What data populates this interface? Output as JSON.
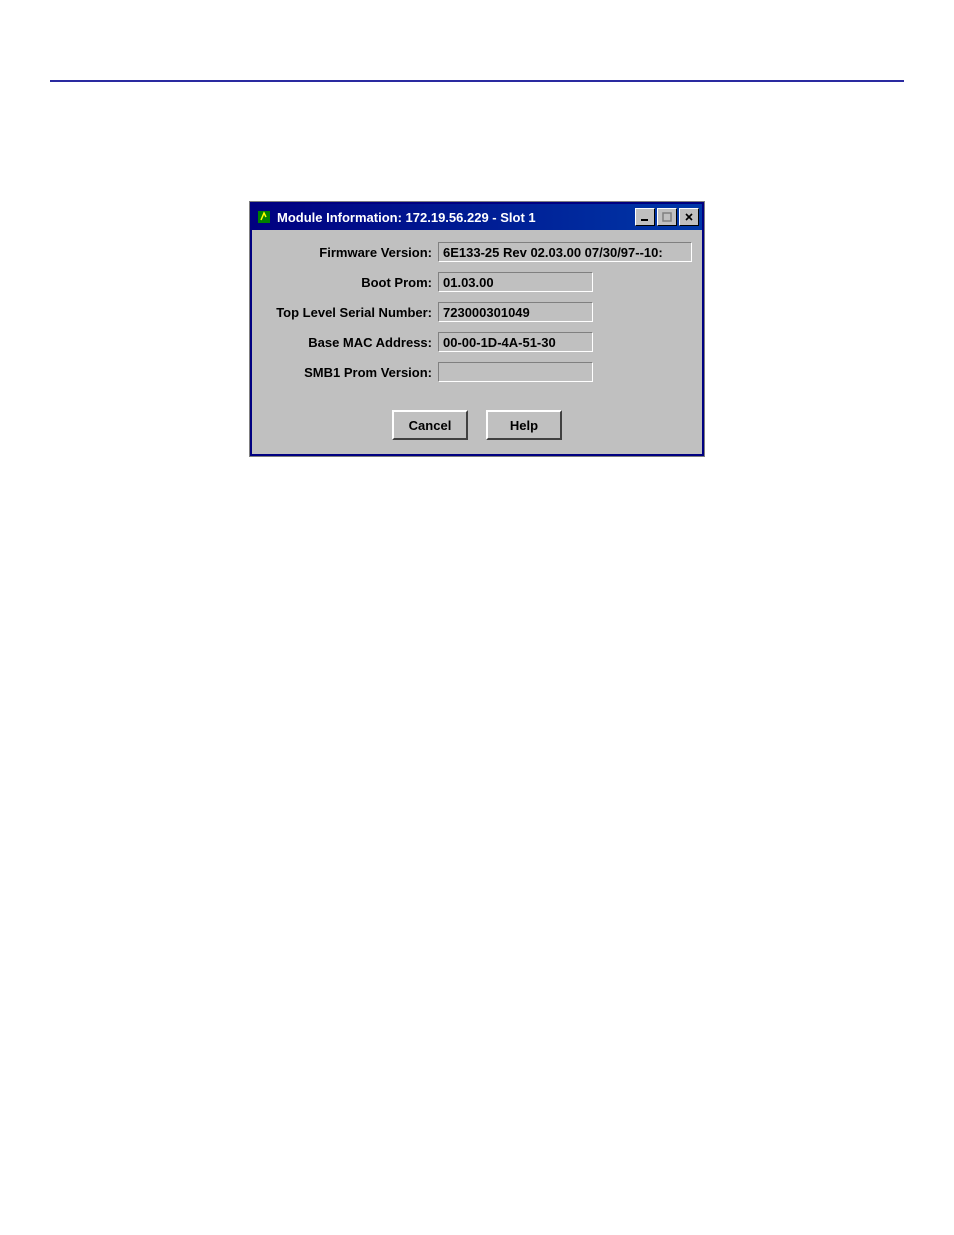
{
  "window": {
    "title": "Module Information: 172.19.56.229 - Slot 1"
  },
  "fields": {
    "firmware_label": "Firmware Version:",
    "firmware_value": "6E133-25 Rev 02.03.00  07/30/97--10:",
    "bootprom_label": "Boot Prom:",
    "bootprom_value": "01.03.00",
    "serial_label": "Top Level Serial Number:",
    "serial_value": "723000301049",
    "mac_label": "Base MAC Address:",
    "mac_value": "00-00-1D-4A-51-30",
    "smb1_label": "SMB1 Prom Version:",
    "smb1_value": ""
  },
  "buttons": {
    "cancel": "Cancel",
    "help": "Help"
  }
}
